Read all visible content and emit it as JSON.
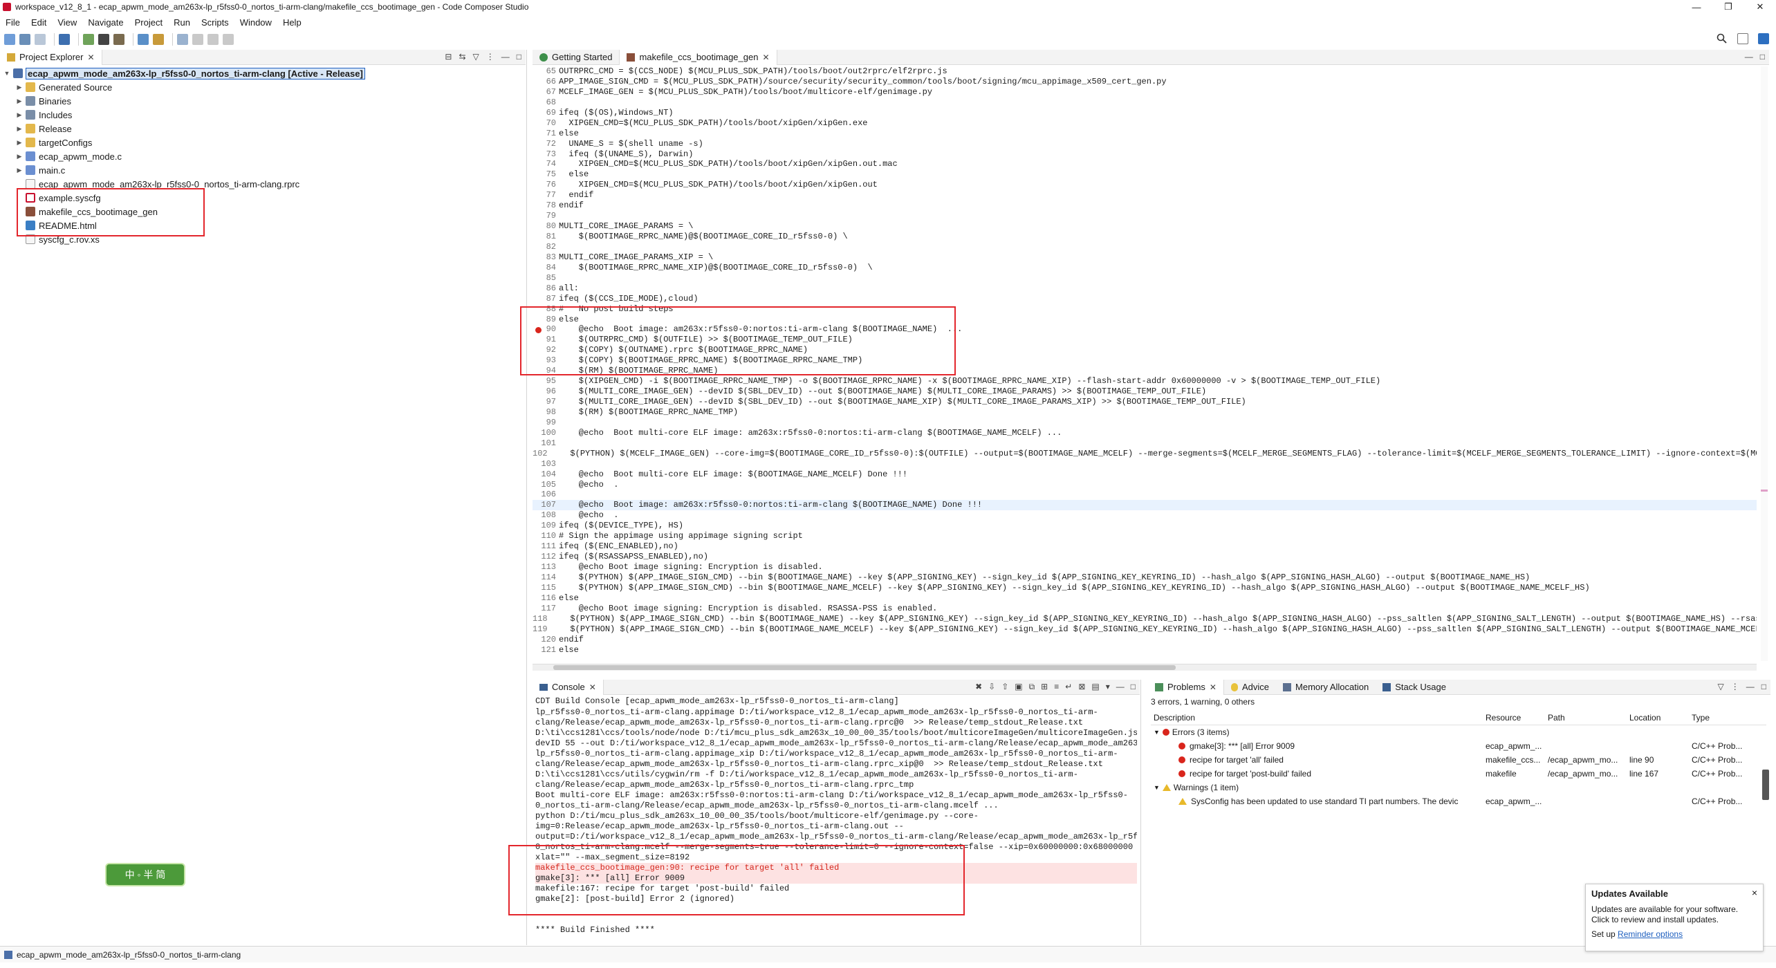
{
  "window": {
    "title": "workspace_v12_8_1 - ecap_apwm_mode_am263x-lp_r5fss0-0_nortos_ti-arm-clang/makefile_ccs_bootimage_gen - Code Composer Studio",
    "controls": [
      "—",
      "❐",
      "✕"
    ]
  },
  "menu": [
    "File",
    "Edit",
    "View",
    "Navigate",
    "Project",
    "Run",
    "Scripts",
    "Window",
    "Help"
  ],
  "explorer": {
    "tab_label": "Project Explorer",
    "root": "ecap_apwm_mode_am263x-lp_r5fss0-0_nortos_ti-arm-clang  [Active - Release]",
    "items": [
      {
        "label": "Generated Source",
        "type": "folder"
      },
      {
        "label": "Binaries",
        "type": "lib"
      },
      {
        "label": "Includes",
        "type": "lib"
      },
      {
        "label": "Release",
        "type": "folder"
      },
      {
        "label": "targetConfigs",
        "type": "folder"
      },
      {
        "label": "ecap_apwm_mode.c",
        "type": "cfile"
      },
      {
        "label": "main.c",
        "type": "cfile"
      },
      {
        "label": "ecap_apwm_mode_am263x-lp_r5fss0-0_nortos_ti-arm-clang.rprc",
        "type": "file"
      },
      {
        "label": "example.syscfg",
        "type": "sys"
      },
      {
        "label": "makefile_ccs_bootimage_gen",
        "type": "make"
      },
      {
        "label": "README.html",
        "type": "html"
      },
      {
        "label": "syscfg_c.rov.xs",
        "type": "file"
      }
    ]
  },
  "editor": {
    "tabs": [
      {
        "label": "Getting Started"
      },
      {
        "label": "makefile_ccs_bootimage_gen"
      }
    ],
    "lines": [
      {
        "n": "65",
        "t": "OUTRPRC_CMD = $(CCS_NODE) $(MCU_PLUS_SDK_PATH)/tools/boot/out2rprc/elf2rprc.js"
      },
      {
        "n": "66",
        "t": "APP_IMAGE_SIGN_CMD = $(MCU_PLUS_SDK_PATH)/source/security/security_common/tools/boot/signing/mcu_appimage_x509_cert_gen.py"
      },
      {
        "n": "67",
        "t": "MCELF_IMAGE_GEN = $(MCU_PLUS_SDK_PATH)/tools/boot/multicore-elf/genimage.py"
      },
      {
        "n": "68",
        "t": ""
      },
      {
        "n": "69",
        "t": "ifeq ($(OS),Windows_NT)"
      },
      {
        "n": "70",
        "t": "  XIPGEN_CMD=$(MCU_PLUS_SDK_PATH)/tools/boot/xipGen/xipGen.exe"
      },
      {
        "n": "71",
        "t": "else"
      },
      {
        "n": "72",
        "t": "  UNAME_S = $(shell uname -s)"
      },
      {
        "n": "73",
        "t": "  ifeq ($(UNAME_S), Darwin)"
      },
      {
        "n": "74",
        "t": "    XIPGEN_CMD=$(MCU_PLUS_SDK_PATH)/tools/boot/xipGen/xipGen.out.mac"
      },
      {
        "n": "75",
        "t": "  else"
      },
      {
        "n": "76",
        "t": "    XIPGEN_CMD=$(MCU_PLUS_SDK_PATH)/tools/boot/xipGen/xipGen.out"
      },
      {
        "n": "77",
        "t": "  endif"
      },
      {
        "n": "78",
        "t": "endif"
      },
      {
        "n": "79",
        "t": ""
      },
      {
        "n": "80",
        "t": "MULTI_CORE_IMAGE_PARAMS = \\"
      },
      {
        "n": "81",
        "t": "    $(BOOTIMAGE_RPRC_NAME)@$(BOOTIMAGE_CORE_ID_r5fss0-0) \\"
      },
      {
        "n": "82",
        "t": ""
      },
      {
        "n": "83",
        "t": "MULTI_CORE_IMAGE_PARAMS_XIP = \\"
      },
      {
        "n": "84",
        "t": "    $(BOOTIMAGE_RPRC_NAME_XIP)@$(BOOTIMAGE_CORE_ID_r5fss0-0)  \\"
      },
      {
        "n": "85",
        "t": ""
      },
      {
        "n": "86",
        "t": "all:"
      },
      {
        "n": "87",
        "t": "ifeq ($(CCS_IDE_MODE),cloud)"
      },
      {
        "n": "88",
        "t": "#   No post build steps"
      },
      {
        "n": "89",
        "t": "else"
      },
      {
        "n": "90",
        "t": "    @echo  Boot image: am263x:r5fss0-0:nortos:ti-arm-clang $(BOOTIMAGE_NAME)  ..."
      },
      {
        "n": "91",
        "t": "    $(OUTRPRC_CMD) $(OUTFILE) >> $(BOOTIMAGE_TEMP_OUT_FILE)"
      },
      {
        "n": "92",
        "t": "    $(COPY) $(OUTNAME).rprc $(BOOTIMAGE_RPRC_NAME)"
      },
      {
        "n": "93",
        "t": "    $(COPY) $(BOOTIMAGE_RPRC_NAME) $(BOOTIMAGE_RPRC_NAME_TMP)"
      },
      {
        "n": "94",
        "t": "    $(RM) $(BOOTIMAGE_RPRC_NAME)"
      },
      {
        "n": "95",
        "t": "    $(XIPGEN_CMD) -i $(BOOTIMAGE_RPRC_NAME_TMP) -o $(BOOTIMAGE_RPRC_NAME) -x $(BOOTIMAGE_RPRC_NAME_XIP) --flash-start-addr 0x60000000 -v > $(BOOTIMAGE_TEMP_OUT_FILE)"
      },
      {
        "n": "96",
        "t": "    $(MULTI_CORE_IMAGE_GEN) --devID $(SBL_DEV_ID) --out $(BOOTIMAGE_NAME) $(MULTI_CORE_IMAGE_PARAMS) >> $(BOOTIMAGE_TEMP_OUT_FILE)"
      },
      {
        "n": "97",
        "t": "    $(MULTI_CORE_IMAGE_GEN) --devID $(SBL_DEV_ID) --out $(BOOTIMAGE_NAME_XIP) $(MULTI_CORE_IMAGE_PARAMS_XIP) >> $(BOOTIMAGE_TEMP_OUT_FILE)"
      },
      {
        "n": "98",
        "t": "    $(RM) $(BOOTIMAGE_RPRC_NAME_TMP)"
      },
      {
        "n": "99",
        "t": ""
      },
      {
        "n": "100",
        "t": "    @echo  Boot multi-core ELF image: am263x:r5fss0-0:nortos:ti-arm-clang $(BOOTIMAGE_NAME_MCELF) ..."
      },
      {
        "n": "101",
        "t": ""
      },
      {
        "n": "102",
        "t": "    $(PYTHON) $(MCELF_IMAGE_GEN) --core-img=$(BOOTIMAGE_CORE_ID_r5fss0-0):$(OUTFILE) --output=$(BOOTIMAGE_NAME_MCELF) --merge-segments=$(MCELF_MERGE_SEGMENTS_FLAG) --tolerance-limit=$(MCELF_MERGE_SEGMENTS_TOLERANCE_LIMIT) --ignore-context=$(MCELF"
      },
      {
        "n": "103",
        "t": ""
      },
      {
        "n": "104",
        "t": "    @echo  Boot multi-core ELF image: $(BOOTIMAGE_NAME_MCELF) Done !!!"
      },
      {
        "n": "105",
        "t": "    @echo  ."
      },
      {
        "n": "106",
        "t": ""
      },
      {
        "n": "107",
        "t": "    @echo  Boot image: am263x:r5fss0-0:nortos:ti-arm-clang $(BOOTIMAGE_NAME) Done !!!"
      },
      {
        "n": "108",
        "t": "    @echo  ."
      },
      {
        "n": "109",
        "t": "ifeq ($(DEVICE_TYPE), HS)"
      },
      {
        "n": "110",
        "t": "# Sign the appimage using appimage signing script"
      },
      {
        "n": "111",
        "t": "ifeq ($(ENC_ENABLED),no)"
      },
      {
        "n": "112",
        "t": "ifeq ($(RSASSAPSS_ENABLED),no)"
      },
      {
        "n": "113",
        "t": "    @echo Boot image signing: Encryption is disabled."
      },
      {
        "n": "114",
        "t": "    $(PYTHON) $(APP_IMAGE_SIGN_CMD) --bin $(BOOTIMAGE_NAME) --key $(APP_SIGNING_KEY) --sign_key_id $(APP_SIGNING_KEY_KEYRING_ID) --hash_algo $(APP_SIGNING_HASH_ALGO) --output $(BOOTIMAGE_NAME_HS)"
      },
      {
        "n": "115",
        "t": "    $(PYTHON) $(APP_IMAGE_SIGN_CMD) --bin $(BOOTIMAGE_NAME_MCELF) --key $(APP_SIGNING_KEY) --sign_key_id $(APP_SIGNING_KEY_KEYRING_ID) --hash_algo $(APP_SIGNING_HASH_ALGO) --output $(BOOTIMAGE_NAME_MCELF_HS)"
      },
      {
        "n": "116",
        "t": "else"
      },
      {
        "n": "117",
        "t": "    @echo Boot image signing: Encryption is disabled. RSASSA-PSS is enabled."
      },
      {
        "n": "118",
        "t": "    $(PYTHON) $(APP_IMAGE_SIGN_CMD) --bin $(BOOTIMAGE_NAME) --key $(APP_SIGNING_KEY) --sign_key_id $(APP_SIGNING_KEY_KEYRING_ID) --hash_algo $(APP_SIGNING_HASH_ALGO) --pss_saltlen $(APP_SIGNING_SALT_LENGTH) --output $(BOOTIMAGE_NAME_HS) --rsassa"
      },
      {
        "n": "119",
        "t": "    $(PYTHON) $(APP_IMAGE_SIGN_CMD) --bin $(BOOTIMAGE_NAME_MCELF) --key $(APP_SIGNING_KEY) --sign_key_id $(APP_SIGNING_KEY_KEYRING_ID) --hash_algo $(APP_SIGNING_HASH_ALGO) --pss_saltlen $(APP_SIGNING_SALT_LENGTH) --output $(BOOTIMAGE_NAME_MCELF_H"
      },
      {
        "n": "120",
        "t": "endif"
      },
      {
        "n": "121",
        "t": "else"
      }
    ]
  },
  "console": {
    "tab_label": "Console",
    "header": "CDT Build Console [ecap_apwm_mode_am263x-lp_r5fss0-0_nortos_ti-arm-clang]",
    "lines": [
      {
        "t": "lp_r5fss0-0_nortos_ti-arm-clang.appimage D:/ti/workspace_v12_8_1/ecap_apwm_mode_am263x-lp_r5fss0-0_nortos_ti-arm-",
        "k": ""
      },
      {
        "t": "clang/Release/ecap_apwm_mode_am263x-lp_r5fss0-0_nortos_ti-arm-clang.rprc@0  >> Release/temp_stdout_Release.txt",
        "k": ""
      },
      {
        "t": "D:\\ti\\ccs1281\\ccs/tools/node/node D:/ti/mcu_plus_sdk_am263x_10_00_00_35/tools/boot/multicoreImageGen/multicoreImageGen.js --",
        "k": ""
      },
      {
        "t": "devID 55 --out D:/ti/workspace_v12_8_1/ecap_apwm_mode_am263x-lp_r5fss0-0_nortos_ti-arm-clang/Release/ecap_apwm_mode_am263x-",
        "k": ""
      },
      {
        "t": "lp_r5fss0-0_nortos_ti-arm-clang.appimage_xip D:/ti/workspace_v12_8_1/ecap_apwm_mode_am263x-lp_r5fss0-0_nortos_ti-arm-",
        "k": ""
      },
      {
        "t": "clang/Release/ecap_apwm_mode_am263x-lp_r5fss0-0_nortos_ti-arm-clang.rprc_xip@0  >> Release/temp_stdout_Release.txt",
        "k": ""
      },
      {
        "t": "D:\\ti\\ccs1281\\ccs/utils/cygwin/rm -f D:/ti/workspace_v12_8_1/ecap_apwm_mode_am263x-lp_r5fss0-0_nortos_ti-arm-",
        "k": ""
      },
      {
        "t": "clang/Release/ecap_apwm_mode_am263x-lp_r5fss0-0_nortos_ti-arm-clang.rprc_tmp",
        "k": ""
      },
      {
        "t": "Boot multi-core ELF image: am263x:r5fss0-0:nortos:ti-arm-clang D:/ti/workspace_v12_8_1/ecap_apwm_mode_am263x-lp_r5fss0-",
        "k": ""
      },
      {
        "t": "0_nortos_ti-arm-clang/Release/ecap_apwm_mode_am263x-lp_r5fss0-0_nortos_ti-arm-clang.mcelf ...",
        "k": ""
      },
      {
        "t": "python D:/ti/mcu_plus_sdk_am263x_10_00_00_35/tools/boot/multicore-elf/genimage.py --core-",
        "k": ""
      },
      {
        "t": "img=0:Release/ecap_apwm_mode_am263x-lp_r5fss0-0_nortos_ti-arm-clang.out --",
        "k": ""
      },
      {
        "t": "output=D:/ti/workspace_v12_8_1/ecap_apwm_mode_am263x-lp_r5fss0-0_nortos_ti-arm-clang/Release/ecap_apwm_mode_am263x-lp_r5fss0",
        "k": ""
      },
      {
        "t": "0_nortos_ti-arm-clang.mcelf --merge-segments=true --tolerance-limit=0 --ignore-context=false --xip=0x60000000:0x68000000 --",
        "k": ""
      },
      {
        "t": "xlat=\"\" --max_segment_size=8192",
        "k": ""
      },
      {
        "t": "makefile_ccs_bootimage_gen:90: recipe for target 'all' failed",
        "k": "err"
      },
      {
        "t": "gmake[3]: *** [all] Error 9009",
        "k": "gm"
      },
      {
        "t": "makefile:167: recipe for target 'post-build' failed",
        "k": ""
      },
      {
        "t": "gmake[2]: [post-build] Error 2 (ignored)",
        "k": ""
      },
      {
        "t": "",
        "k": ""
      },
      {
        "t": "",
        "k": ""
      },
      {
        "t": "**** Build Finished ****",
        "k": ""
      }
    ]
  },
  "problems": {
    "tabs": [
      "Problems",
      "Advice",
      "Memory Allocation",
      "Stack Usage"
    ],
    "summary": "3 errors, 1 warning, 0 others",
    "columns": [
      "Description",
      "Resource",
      "Path",
      "Location",
      "Type"
    ],
    "groups": [
      {
        "label": "Errors (3 items)",
        "rows": [
          {
            "desc": "gmake[3]: *** [all] Error 9009",
            "res": "ecap_apwm_...",
            "path": "",
            "loc": "",
            "type": "C/C++ Prob..."
          },
          {
            "desc": "recipe for target 'all' failed",
            "res": "makefile_ccs...",
            "path": "/ecap_apwm_mo...",
            "loc": "line 90",
            "type": "C/C++ Prob..."
          },
          {
            "desc": "recipe for target 'post-build' failed",
            "res": "makefile",
            "path": "/ecap_apwm_mo...",
            "loc": "line 167",
            "type": "C/C++ Prob..."
          }
        ]
      },
      {
        "label": "Warnings (1 item)",
        "rows": [
          {
            "desc": "SysConfig has been updated to use standard TI part numbers. The devic",
            "res": "ecap_apwm_...",
            "path": "",
            "loc": "",
            "type": "C/C++ Prob..."
          }
        ]
      }
    ]
  },
  "status_bar": {
    "text": "ecap_apwm_mode_am263x-lp_r5fss0-0_nortos_ti-arm-clang"
  },
  "updates_popup": {
    "title": "Updates Available",
    "body1": "Updates are available for your software.",
    "body2": "Click to review and install updates.",
    "setup_prefix": "Set up ",
    "link": "Reminder options",
    "close": "×"
  },
  "ime_badge": {
    "text": "中 ◦ 半 简"
  },
  "colors": {
    "error": "#d9251c",
    "annotation": "#e3262c",
    "selection": "#d8e6f6"
  }
}
